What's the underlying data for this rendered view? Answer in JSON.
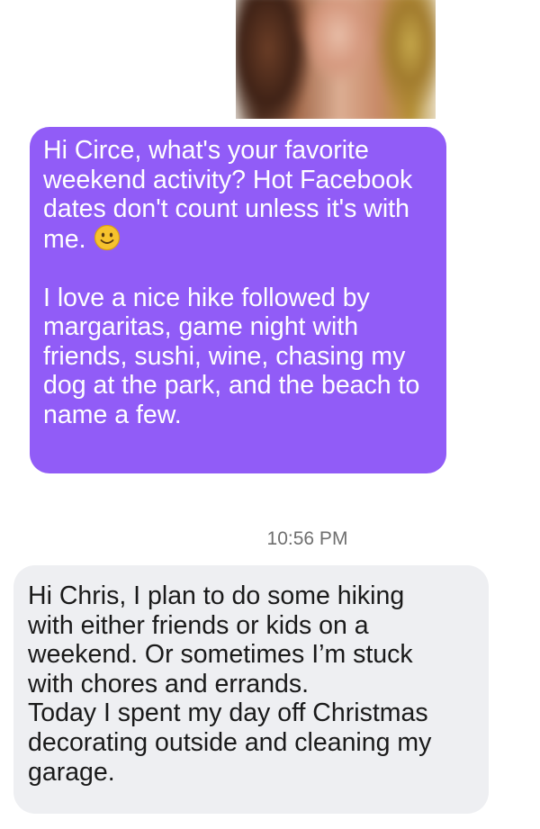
{
  "conversation": {
    "outgoing": {
      "paragraphs": [
        "Hi Circe, what's your favorite weekend activity? Hot Facebook dates don't count unless it's with me.",
        "I love a nice hike followed by margaritas, game night with friends, sushi, wine, chasing my dog at the park, and the beach to name a few."
      ],
      "emoji": "slightly-smiling-face",
      "bubble_color": "#915cf7",
      "text_color": "#ffffff"
    },
    "timestamp": "10:56 PM",
    "incoming": {
      "lines": [
        "Hi Chris, I plan to do some hiking",
        "with either friends or kids on a",
        "weekend. Or sometimes I’m stuck",
        "with chores and errands.",
        "Today I spent my day off Christmas",
        "decorating outside and cleaning my",
        "garage."
      ],
      "bubble_color": "#eeeff2",
      "text_color": "#1a1a1a"
    }
  }
}
